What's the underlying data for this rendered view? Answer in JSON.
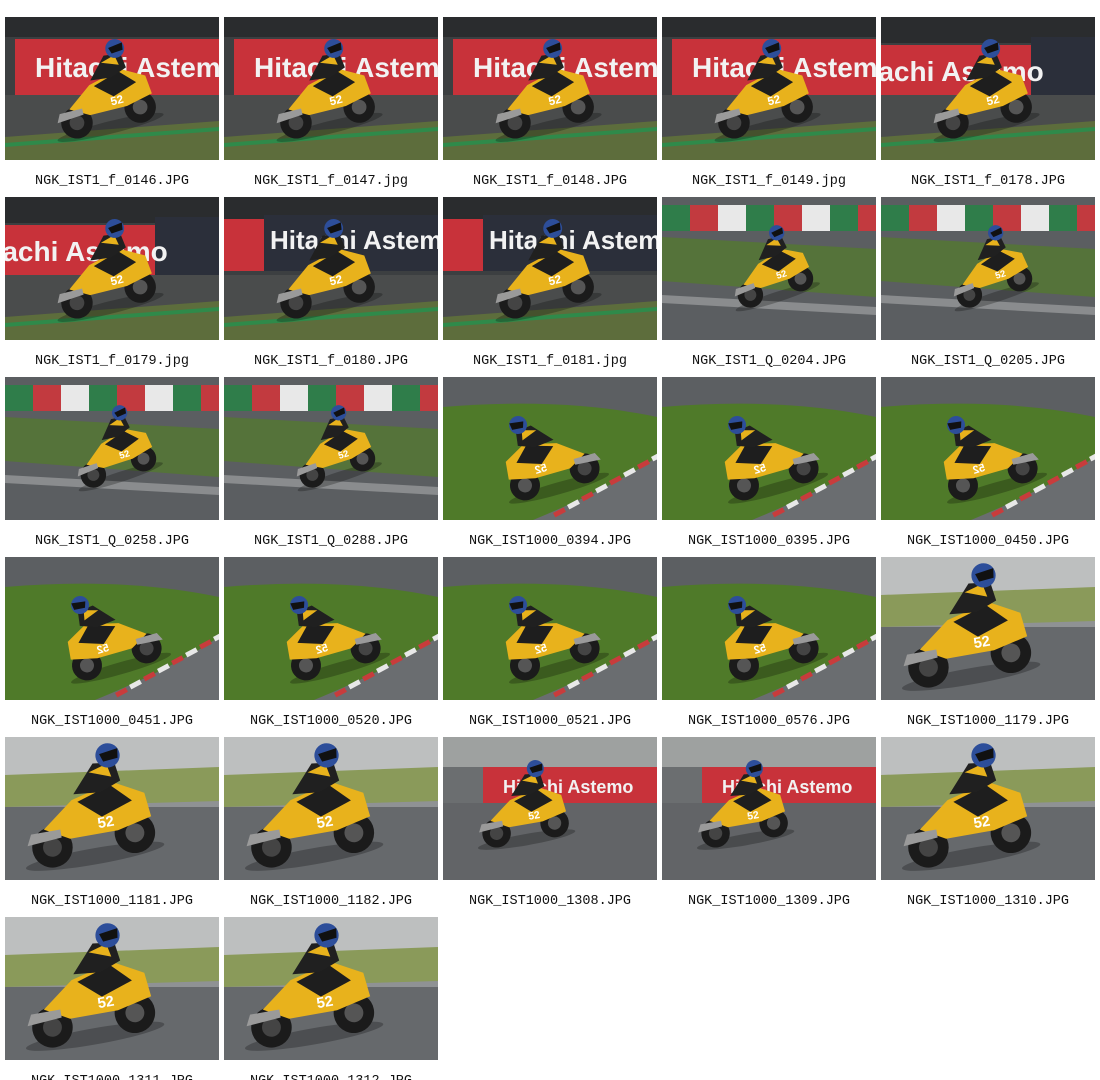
{
  "gallery": {
    "items": [
      {
        "filename": "NGK_IST1_f_0146.JPG",
        "scene": "banner-red"
      },
      {
        "filename": "NGK_IST1_f_0147.jpg",
        "scene": "banner-red"
      },
      {
        "filename": "NGK_IST1_f_0148.JPG",
        "scene": "banner-red"
      },
      {
        "filename": "NGK_IST1_f_0149.jpg",
        "scene": "banner-red"
      },
      {
        "filename": "NGK_IST1_f_0178.JPG",
        "scene": "banner-mixed"
      },
      {
        "filename": "NGK_IST1_f_0179.jpg",
        "scene": "banner-mixed"
      },
      {
        "filename": "NGK_IST1_f_0180.JPG",
        "scene": "banner-dark"
      },
      {
        "filename": "NGK_IST1_f_0181.jpg",
        "scene": "banner-dark"
      },
      {
        "filename": "NGK_IST1_Q_0204.JPG",
        "scene": "kerb-wall"
      },
      {
        "filename": "NGK_IST1_Q_0205.JPG",
        "scene": "kerb-wall"
      },
      {
        "filename": "NGK_IST1_Q_0258.JPG",
        "scene": "kerb-wall"
      },
      {
        "filename": "NGK_IST1_Q_0288.JPG",
        "scene": "kerb-wall"
      },
      {
        "filename": "NGK_IST1000_0394.JPG",
        "scene": "grass-curve"
      },
      {
        "filename": "NGK_IST1000_0395.JPG",
        "scene": "grass-curve"
      },
      {
        "filename": "NGK_IST1000_0450.JPG",
        "scene": "grass-curve"
      },
      {
        "filename": "NGK_IST1000_0451.JPG",
        "scene": "grass-curve"
      },
      {
        "filename": "NGK_IST1000_0520.JPG",
        "scene": "grass-curve"
      },
      {
        "filename": "NGK_IST1000_0521.JPG",
        "scene": "grass-curve"
      },
      {
        "filename": "NGK_IST1000_0576.JPG",
        "scene": "grass-curve"
      },
      {
        "filename": "NGK_IST1000_1179.JPG",
        "scene": "closeup"
      },
      {
        "filename": "NGK_IST1000_1181.JPG",
        "scene": "closeup"
      },
      {
        "filename": "NGK_IST1000_1182.JPG",
        "scene": "closeup"
      },
      {
        "filename": "NGK_IST1000_1308.JPG",
        "scene": "banner-far"
      },
      {
        "filename": "NGK_IST1000_1309.JPG",
        "scene": "banner-far"
      },
      {
        "filename": "NGK_IST1000_1310.JPG",
        "scene": "closeup"
      },
      {
        "filename": "NGK_IST1000_1311.JPG",
        "scene": "closeup"
      },
      {
        "filename": "NGK_IST1000_1312.JPG",
        "scene": "closeup"
      }
    ]
  },
  "banner_text": "Hitachi Astemo",
  "bike_number": "52",
  "colors": {
    "bike_yellow": "#e8b21c",
    "banner_red": "#c8323a",
    "grass": "#4e7a2a",
    "asphalt": "#5a5d60"
  }
}
